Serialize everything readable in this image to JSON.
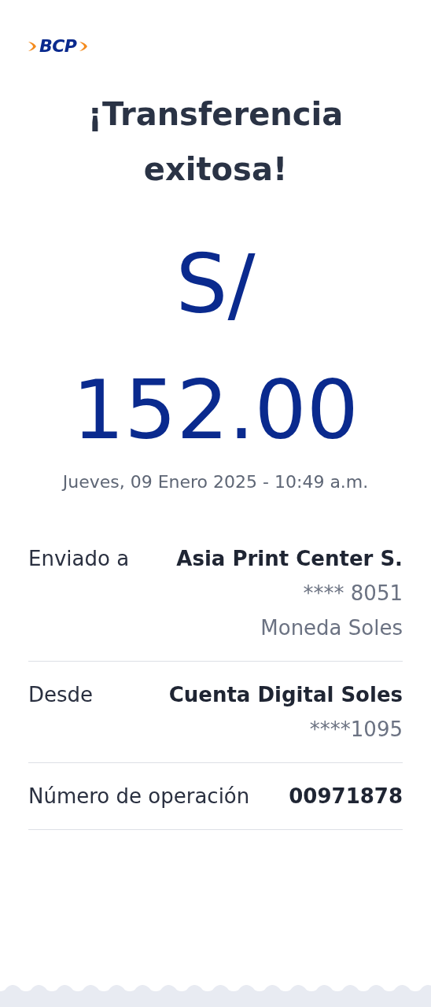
{
  "logo": {
    "text": "BCP"
  },
  "title": "¡Transferencia exitosa!",
  "amount": {
    "currency": "S/",
    "value": "152.00"
  },
  "date": "Jueves, 09 Enero 2025 - 10:49 a.m.",
  "details": [
    {
      "label": "Enviado a",
      "lines": [
        {
          "text": "Asia Print Center S.",
          "kind": "strong"
        },
        {
          "text": "**** 8051",
          "kind": "muted"
        },
        {
          "text": "Moneda Soles",
          "kind": "muted"
        }
      ]
    },
    {
      "label": "Desde",
      "lines": [
        {
          "text": "Cuenta Digital Soles",
          "kind": "strong"
        },
        {
          "text": "****1095",
          "kind": "muted"
        }
      ]
    },
    {
      "label": "Número de operación",
      "lines": [
        {
          "text": "00971878",
          "kind": "strong"
        }
      ]
    }
  ]
}
